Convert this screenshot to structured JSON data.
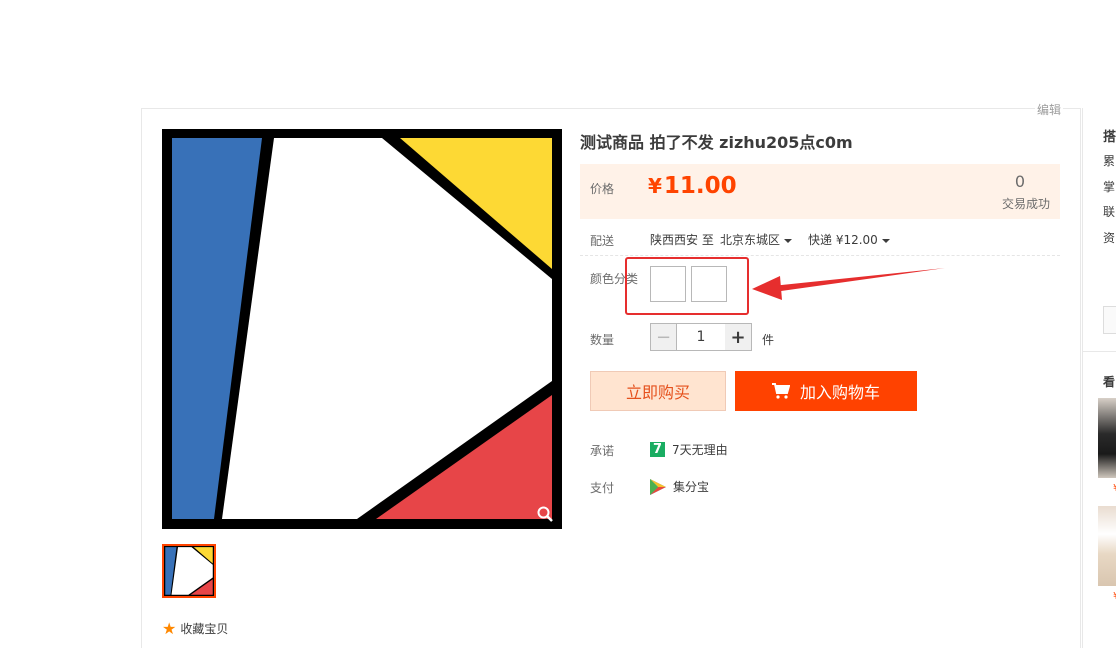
{
  "top_bar": {
    "edit_link": "编辑"
  },
  "gallery": {
    "zoom_icon": "zoom-icon",
    "favorite_label": "收藏宝贝",
    "colors": {
      "blue": "#3871b8",
      "yellow": "#fdd934",
      "red": "#e74548",
      "frame": "#000000"
    }
  },
  "product": {
    "title": "测试商品 拍了不发 zizhu205点c0m",
    "price_label": "价格",
    "currency": "¥",
    "price": "11.00",
    "deal_count": "0",
    "deal_label": "交易成功",
    "delivery": {
      "label": "配送",
      "from": "陕西西安 至",
      "to": "北京东城区",
      "shipping": "快递 ¥12.00"
    },
    "color_label": "颜色分类",
    "quantity_label": "数量",
    "quantity": "1",
    "unit": "件",
    "buy_now_label": "立即购买",
    "add_to_cart_label": "加入购物车",
    "promise_label": "承诺",
    "promise_icon_text": "7",
    "promise_text": "7天无理由",
    "pay_label": "支付",
    "pay_text": "集分宝",
    "accent_color": "#ff4200"
  },
  "sidebar": {
    "title": "搭",
    "lines": [
      "累",
      "掌",
      "联",
      "资"
    ],
    "see_also": "看"
  }
}
